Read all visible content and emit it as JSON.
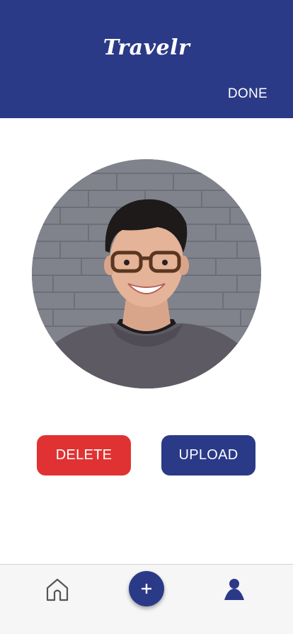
{
  "header": {
    "app_title": "Travelr",
    "done_label": "DONE"
  },
  "profile": {
    "photo_icon": "profile-photo"
  },
  "actions": {
    "delete_label": "DELETE",
    "upload_label": "UPLOAD"
  },
  "tabbar": {
    "items": [
      {
        "icon": "home-icon"
      },
      {
        "icon": "plus-icon"
      },
      {
        "icon": "person-icon"
      }
    ]
  },
  "colors": {
    "brand": "#2b3a87",
    "danger": "#e03232",
    "tabbar_bg": "#f6f6f6"
  }
}
